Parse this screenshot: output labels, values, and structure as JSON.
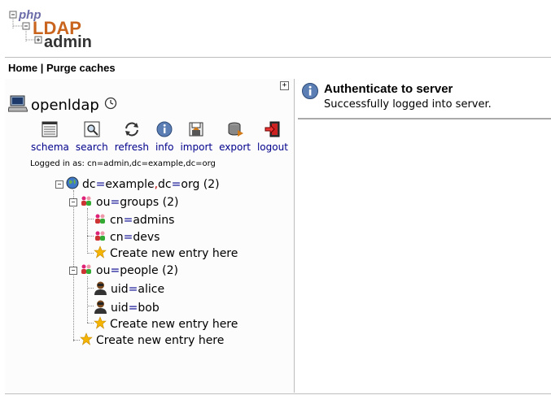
{
  "logo": {
    "php": "php",
    "ldap": "LDAP",
    "admin": "admin"
  },
  "topnav": {
    "home": "Home",
    "separator": "|",
    "purge": "Purge caches"
  },
  "server": {
    "name": "openldap"
  },
  "toolbar": {
    "schema": "schema",
    "search": "search",
    "refresh": "refresh",
    "info": "info",
    "import": "import",
    "export": "export",
    "logout": "logout"
  },
  "logged_in": "Logged in as: cn=admin,dc=example,dc=org",
  "tree": {
    "root": {
      "a_key": "dc",
      "a_val": "example",
      "b_key": "dc",
      "b_val": "org",
      "count": "(2)"
    },
    "groups": {
      "key": "ou",
      "val": "groups",
      "count": "(2)"
    },
    "admins": {
      "key": "cn",
      "val": "admins"
    },
    "devs": {
      "key": "cn",
      "val": "devs"
    },
    "people": {
      "key": "ou",
      "val": "people",
      "count": "(2)"
    },
    "alice": {
      "key": "uid",
      "val": "alice"
    },
    "bob": {
      "key": "uid",
      "val": "bob"
    },
    "create_label": "Create new entry here"
  },
  "message": {
    "title": "Authenticate to server",
    "text": "Successfully logged into server."
  },
  "icons": {
    "expand": "expand-icon",
    "server": "server-icon",
    "clock": "clock-icon",
    "globe": "globe-icon",
    "group": "group-icon",
    "user": "user-icon",
    "star": "star-icon",
    "info": "info-icon"
  },
  "colors": {
    "link": "#00008b",
    "comma": "#c00000",
    "logo_purple": "#6c6ca8",
    "logo_orange": "#c8641e",
    "logo_gray": "#333333"
  }
}
